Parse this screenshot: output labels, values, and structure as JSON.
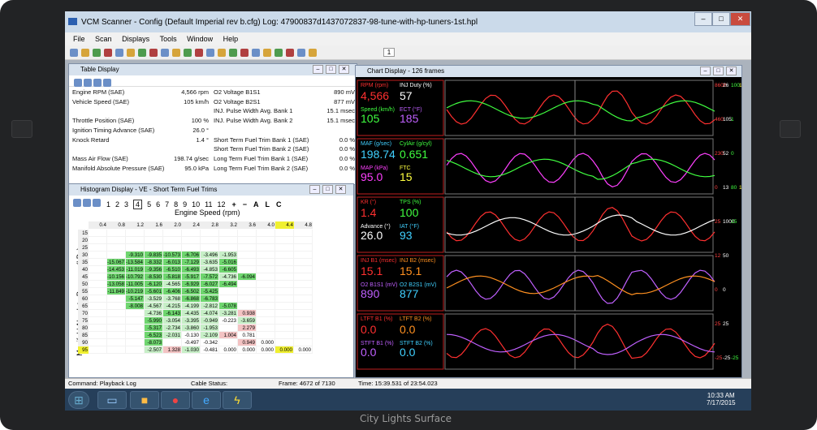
{
  "window": {
    "title": "VCM Scanner  -  Config  (Default Imperial rev b.cfg)   Log: 47900837d1437072837-98-tune-with-hp-tuners-1st.hpl"
  },
  "menu": [
    "File",
    "Scan",
    "Displays",
    "Tools",
    "Window",
    "Help"
  ],
  "toolbar": {
    "page_value": "1"
  },
  "table_display": {
    "title": "Table Display",
    "left": [
      [
        "Engine RPM (SAE)",
        "4,566 rpm"
      ],
      [
        "Vehicle Speed (SAE)",
        "105 km/h"
      ],
      [
        "",
        ""
      ],
      [
        "Throttle Position (SAE)",
        "100 %"
      ],
      [
        "Ignition Timing Advance (SAE)",
        "26.0 °"
      ],
      [
        "Knock Retard",
        "1.4 °"
      ],
      [
        "",
        ""
      ],
      [
        "Mass Air Flow (SAE)",
        "198.74 g/sec"
      ],
      [
        "Manifold Absolute Pressure (SAE)",
        "95.0 kPa"
      ]
    ],
    "right": [
      [
        "O2 Voltage B1S1",
        "890 mV"
      ],
      [
        "O2 Voltage B2S1",
        "877 mV"
      ],
      [
        "INJ. Pulse Width Avg. Bank 1",
        "15.1 msec"
      ],
      [
        "INJ. Pulse Width Avg. Bank 2",
        "15.1 msec"
      ],
      [
        "",
        ""
      ],
      [
        "Short Term Fuel Trim Bank 1 (SAE)",
        "0.0 %"
      ],
      [
        "Short Term Fuel Trim Bank 2 (SAE)",
        "0.0 %"
      ],
      [
        "Long Term Fuel Trim Bank 1 (SAE)",
        "0.0 %"
      ],
      [
        "Long Term Fuel Trim Bank 2 (SAE)",
        "0.0 %"
      ]
    ]
  },
  "histogram": {
    "title": "Histogram Display  -  VE - Short Term Fuel Trims",
    "tabs": [
      "1",
      "2",
      "3",
      "4",
      "5",
      "6",
      "7",
      "8",
      "9",
      "10",
      "11",
      "12"
    ],
    "extra": [
      "+",
      "−",
      "A",
      "L",
      "C"
    ],
    "x_title": "Engine Speed (rpm)",
    "y_title": "Manifold Absolute Pressure (kPa)",
    "cols": [
      "0.4",
      "0.8",
      "1.2",
      "1.6",
      "2.0",
      "2.4",
      "2.8",
      "3.2",
      "3.6",
      "4.0",
      "4.4",
      "4.8"
    ],
    "rows": [
      "15",
      "20",
      "25",
      "30",
      "35",
      "40",
      "45",
      "50",
      "55",
      "60",
      "65",
      "70",
      "75",
      "80",
      "85",
      "90",
      "95"
    ],
    "cells": [
      [
        "",
        "",
        "",
        "",
        "",
        "",
        "",
        "",
        "",
        "",
        "",
        ""
      ],
      [
        "",
        "",
        "",
        "",
        "",
        "",
        "",
        "",
        "",
        "",
        "",
        ""
      ],
      [
        "",
        "",
        "",
        "",
        "",
        "",
        "",
        "",
        "",
        "",
        "",
        ""
      ],
      [
        "",
        "",
        "-9.310",
        "-9.835",
        "-10.573",
        "-6.706",
        "-3.496",
        "-1.953",
        "",
        "",
        "",
        ""
      ],
      [
        "",
        "-15.067",
        "-13.584",
        "-8.332",
        "-6.013",
        "-7.129",
        "-3.635",
        "-5.016",
        "",
        "",
        "",
        ""
      ],
      [
        "",
        "-14.453",
        "-11.019",
        "-9.356",
        "-6.510",
        "-6.493",
        "-4.853",
        "-6.605",
        "",
        "",
        "",
        ""
      ],
      [
        "",
        "-10.156",
        "-10.792",
        "-8.530",
        "-5.818",
        "-5.917",
        "-7.572",
        "-4.736",
        "-6.094",
        "",
        "",
        ""
      ],
      [
        "",
        "-13.058",
        "-11.005",
        "-6.120",
        "-4.565",
        "-6.929",
        "-6.027",
        "-6.494",
        "",
        "",
        "",
        ""
      ],
      [
        "",
        "-11.849",
        "-10.219",
        "-5.601",
        "-6.406",
        "-6.502",
        "-5.425",
        "",
        "",
        "",
        "",
        ""
      ],
      [
        "",
        "",
        "-5.147",
        "-3.529",
        "-3.768",
        "-6.868",
        "-6.783",
        "",
        "",
        "",
        "",
        ""
      ],
      [
        "",
        "",
        "-8.008",
        "-4.567",
        "-4.215",
        "-4.199",
        "-2.812",
        "-5.078",
        "",
        "",
        "",
        ""
      ],
      [
        "",
        "",
        "",
        "-4.736",
        "-6.143",
        "-4.435",
        "-4.074",
        "-3.281",
        "0.938",
        "",
        "",
        ""
      ],
      [
        "",
        "",
        "",
        "-5.990",
        "-3.054",
        "-3.395",
        "-0.949",
        "-0.223",
        "-3.659",
        "",
        "",
        ""
      ],
      [
        "",
        "",
        "",
        "-5.317",
        "-2.734",
        "-3.860",
        "-1.953",
        "",
        "2.279",
        "",
        "",
        ""
      ],
      [
        "",
        "",
        "",
        "-6.523",
        "-2.031",
        "-0.130",
        "-2.109",
        "1.004",
        "0.781",
        "",
        "",
        ""
      ],
      [
        "",
        "",
        "",
        "-8.073",
        "",
        "-0.497",
        "-0.342",
        "",
        "0.949",
        "0.000",
        "",
        ""
      ],
      [
        "",
        "",
        "",
        "-2.507",
        "1.328",
        "-1.030",
        "-0.481",
        "0.000",
        "0.000",
        "0.000",
        "0.000",
        "0.000"
      ]
    ]
  },
  "chart": {
    "title": "Chart Display  -  126 frames",
    "panels": [
      {
        "l1": "RPM (rpm)",
        "v1": "4,566",
        "l2": "INJ Duty (%)",
        "v2": "57",
        "l3": "Speed (km/h)",
        "v3": "105",
        "l4": "ECT (°F)",
        "v4": "185",
        "c1": "#ff3030",
        "c2": "#ffffff",
        "c3": "#40ff40",
        "c4": "#c060ff"
      },
      {
        "l1": "MAF (g/sec)",
        "v1": "198.74",
        "l2": "CylAir (g/cyl)",
        "v2": "0.651",
        "l3": "MAP (kPa)",
        "v3": "95.0",
        "l4": "FTC",
        "v4": "15",
        "c1": "#40d0ff",
        "c2": "#40ff40",
        "c3": "#ff40ff",
        "c4": "#ffff40"
      },
      {
        "l1": "KR (°)",
        "v1": "1.4",
        "l2": "TPS (%)",
        "v2": "100",
        "l3": "Advance (°)",
        "v3": "26.0",
        "l4": "IAT (°F)",
        "v4": "93",
        "c1": "#ff3030",
        "c2": "#40ff40",
        "c3": "#ffffff",
        "c4": "#40d0ff"
      },
      {
        "l1": "INJ B1 (msec)",
        "v1": "15.1",
        "l2": "INJ B2 (msec)",
        "v2": "15.1",
        "l3": "O2 B1S1 (mV)",
        "v3": "890",
        "l4": "O2 B2S1 (mV)",
        "v4": "877",
        "c1": "#ff3030",
        "c2": "#ff9020",
        "c3": "#c060ff",
        "c4": "#40d0ff"
      },
      {
        "l1": "LTFT B1 (%)",
        "v1": "0.0",
        "l2": "LTFT B2 (%)",
        "v2": "0.0",
        "l3": "STFT B1 (%)",
        "v3": "0.0",
        "l4": "STFT B2 (%)",
        "v4": "0.0",
        "c1": "#ff3030",
        "c2": "#ff9020",
        "c3": "#c060ff",
        "c4": "#40d0ff"
      }
    ],
    "scales": [
      [
        "8600",
        "26",
        "100",
        "150"
      ],
      [
        "460",
        "105",
        "1"
      ],
      [
        "230",
        "52",
        "0"
      ],
      [
        "0",
        "13",
        "80",
        "150"
      ],
      [
        "25",
        "1000",
        "15"
      ],
      [
        "12",
        "50"
      ],
      [
        "0",
        "0"
      ],
      [
        "25",
        "25"
      ],
      [
        "-25",
        "-25",
        "-25"
      ]
    ]
  },
  "status": {
    "command": "Command:  Playback Log",
    "cable": "Cable Status:",
    "frame": "Frame:  4672 of 7130",
    "time": "Time:  15:39.531 of 23:54.023"
  },
  "clock": {
    "time": "10:33 AM",
    "date": "7/17/2015"
  },
  "device_caption": "City Lights Surface"
}
